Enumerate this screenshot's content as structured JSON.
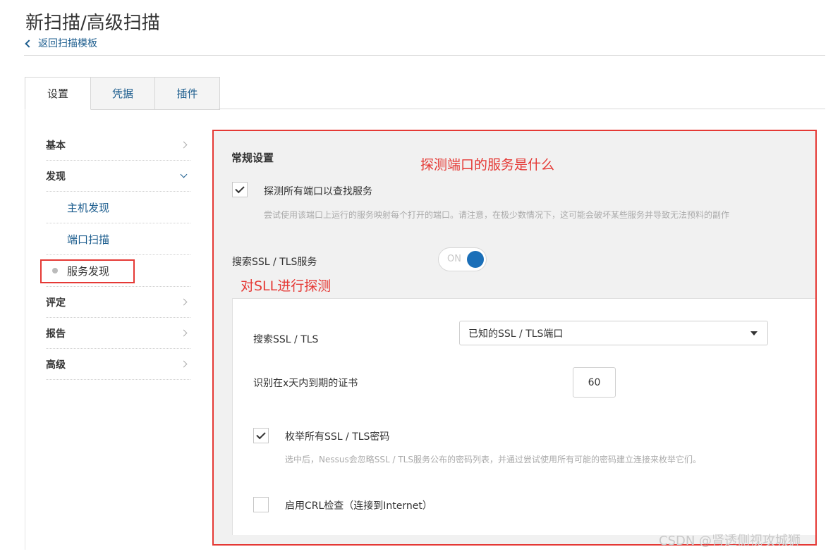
{
  "header": {
    "title": "新扫描/高级扫描",
    "back_link": "返回扫描模板"
  },
  "tabs": [
    {
      "label": "设置",
      "active": true
    },
    {
      "label": "凭据",
      "active": false
    },
    {
      "label": "插件",
      "active": false
    }
  ],
  "sidebar": {
    "items": [
      {
        "label": "基本"
      },
      {
        "label": "发现"
      },
      {
        "label": "主机发现"
      },
      {
        "label": "端口扫描"
      },
      {
        "label": "服务发现"
      },
      {
        "label": "评定"
      },
      {
        "label": "报告"
      },
      {
        "label": "高级"
      }
    ]
  },
  "main": {
    "section_title": "常规设置",
    "probe_all_ports": {
      "label": "探测所有端口以查找服务",
      "checked": true,
      "description": "尝试使用该端口上运行的服务映射每个打开的端口。请注意，在极少数情况下，这可能会破坏某些服务并导致无法预料的副作"
    },
    "ssl_service": {
      "label": "搜索SSL / TLS服务",
      "toggle_text": "ON",
      "on": true
    },
    "ssl_search": {
      "label": "搜索SSL / TLS",
      "selected": "已知的SSL / TLS端口"
    },
    "cert_expiry": {
      "label": "识别在x天内到期的证书",
      "value": "60"
    },
    "enumerate_ciphers": {
      "label": "枚举所有SSL / TLS密码",
      "checked": true,
      "description": "选中后，Nessus会忽略SSL / TLS服务公布的密码列表，并通过尝试使用所有可能的密码建立连接来枚举它们。"
    },
    "crl_check": {
      "label": "启用CRL检查（连接到Internet）",
      "checked": false
    }
  },
  "annotations": {
    "probe_note": "探测端口的服务是什么",
    "ssl_note": "对SLL进行探测",
    "highlight_color": "#e53935"
  },
  "watermark": "CSDN @肾透侧视攻城狮",
  "colors": {
    "link": "#1c5d8e",
    "toggle_on": "#1b6fb8",
    "panel_bg": "#f1f1f1"
  }
}
